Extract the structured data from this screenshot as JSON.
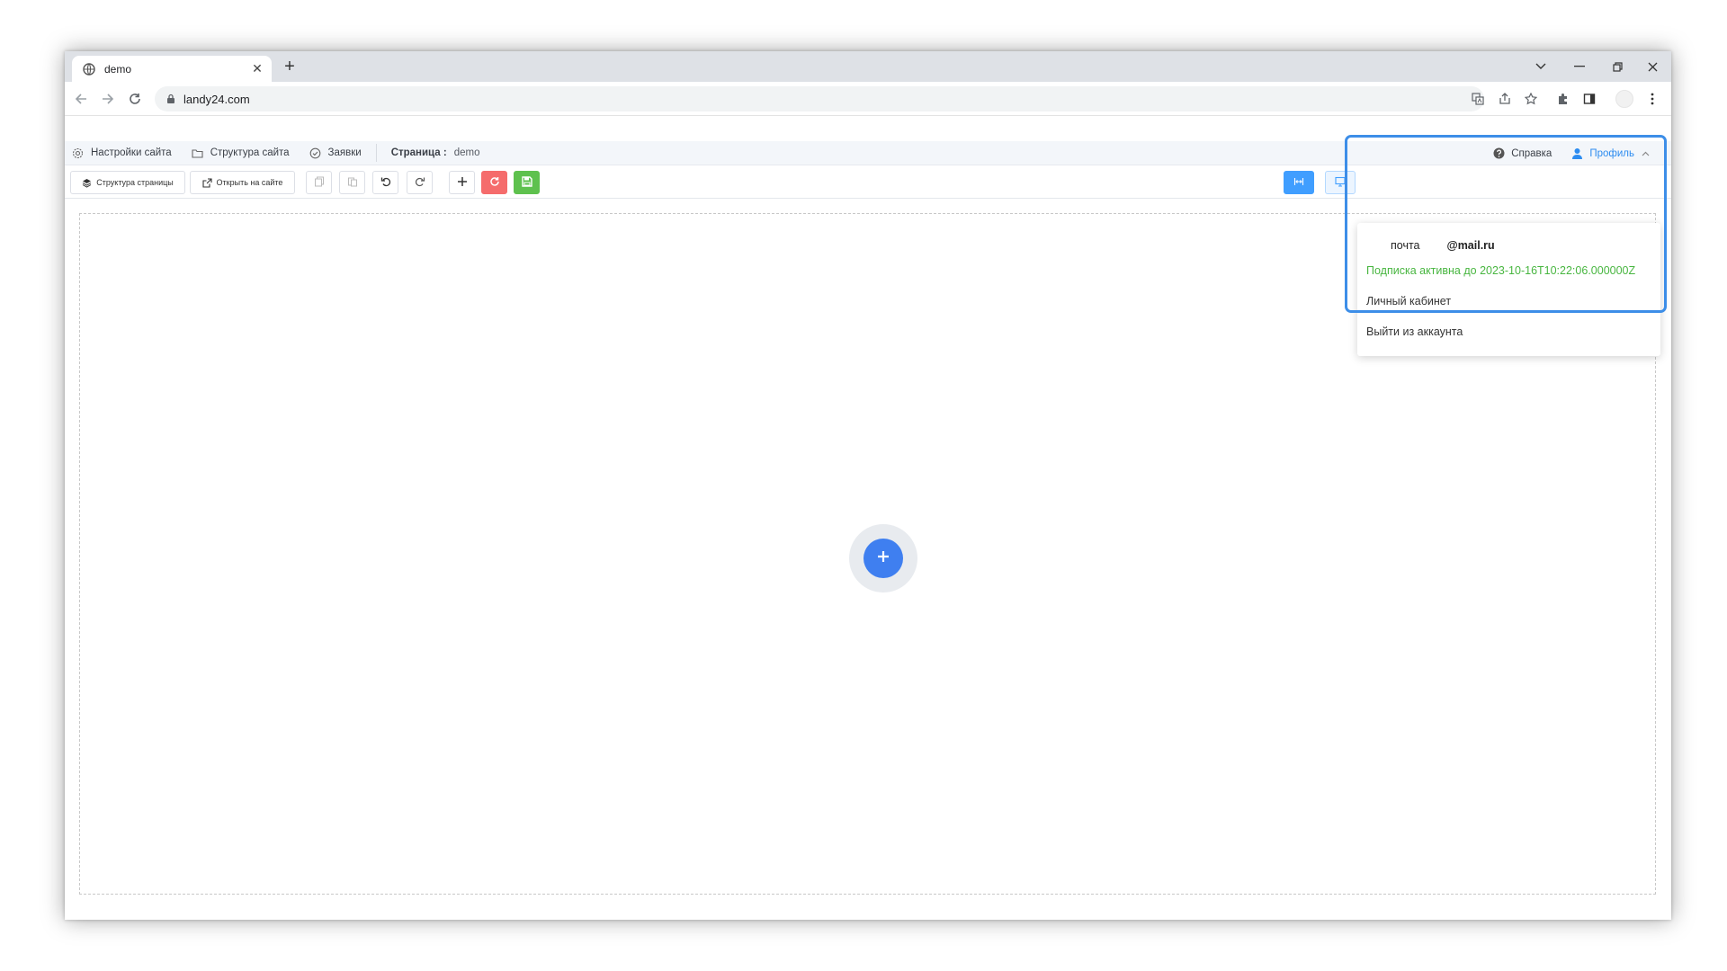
{
  "browser": {
    "tab_title": "demo",
    "tab_close_glyph": "✕",
    "new_tab_glyph": "+",
    "url": "landy24.com",
    "window_controls": [
      "⌄",
      "—",
      "❐",
      "✕"
    ]
  },
  "nav": {
    "site_settings": "Настройки сайта",
    "site_structure": "Структура сайта",
    "requests": "Заявки",
    "page_label": "Страница :",
    "page_value": "demo",
    "help": "Справка",
    "profile": "Профиль"
  },
  "editbar": {
    "page_structure": "Структура страницы",
    "open_on_site": "Открыть на сайте"
  },
  "dropdown": {
    "email_user": "почта",
    "email_domain": "@mail.ru",
    "subscription": "Подписка активна до 2023-10-16T10:22:06.000000Z",
    "cabinet": "Личный кабинет",
    "logout": "Выйти из аккаунта"
  },
  "colors": {
    "accent": "#2d8cf0",
    "highlight": "#3d8ee8",
    "success": "#48b640",
    "danger": "#f56c6c",
    "add_button": "#3f7ff0"
  },
  "icons": [
    "globe-icon",
    "back-arrow-icon",
    "forward-arrow-icon",
    "reload-icon",
    "lock-icon",
    "translate-icon",
    "share-icon",
    "star-icon",
    "extensions-icon",
    "side-panel-icon",
    "menu-dots-icon",
    "gear-icon",
    "folder-icon",
    "check-circle-icon",
    "help-icon",
    "user-icon",
    "chevron-up-icon",
    "layers-icon",
    "external-link-icon",
    "copy-icon",
    "paste-icon",
    "undo-icon",
    "redo-icon",
    "plus-icon",
    "refresh-icon",
    "save-icon",
    "fit-width-icon",
    "desktop-icon"
  ]
}
